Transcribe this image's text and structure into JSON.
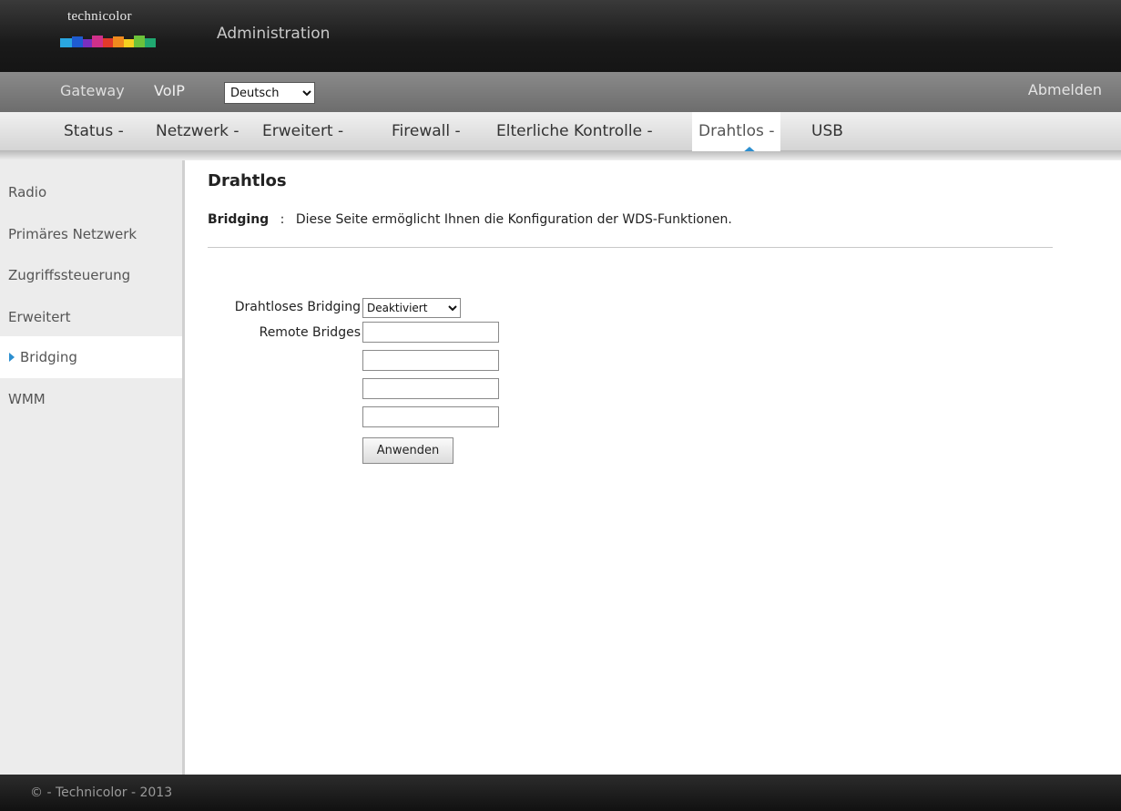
{
  "header": {
    "logo_text": "technicolor",
    "title": "Administration"
  },
  "topnav": {
    "gateway_label": "Gateway",
    "voip_label": "VoIP",
    "language_selected": "Deutsch",
    "logout_label": "Abmelden"
  },
  "mainnav": {
    "tabs": [
      {
        "label": "Status -"
      },
      {
        "label": "Netzwerk -"
      },
      {
        "label": "Erweitert -"
      },
      {
        "label": "Firewall -"
      },
      {
        "label": "Elterliche Kontrolle -"
      },
      {
        "label": "Drahtlos -",
        "active": true
      },
      {
        "label": "USB"
      }
    ]
  },
  "sidebar": {
    "items": [
      {
        "label": "Radio"
      },
      {
        "label": "Primäres Netzwerk"
      },
      {
        "label": "Zugriffssteuerung"
      },
      {
        "label": "Erweitert"
      },
      {
        "label": "Bridging",
        "active": true
      },
      {
        "label": "WMM"
      }
    ]
  },
  "main": {
    "page_title": "Drahtlos",
    "desc_label": "Bridging",
    "desc_separator": ":",
    "desc_text": "Diese Seite ermöglicht Ihnen die Konfiguration der WDS-Funktionen.",
    "wireless_bridging_label": "Drahtloses Bridging",
    "wireless_bridging_value": "Deaktiviert",
    "remote_bridges_label": "Remote Bridges",
    "remote_bridges_values": [
      "",
      "",
      "",
      ""
    ],
    "apply_label": "Anwenden"
  },
  "footer": {
    "text": "© - Technicolor - 2013"
  },
  "colors": {
    "accent": "#2c8fd0",
    "header_bg": "#1a1a1a",
    "topnav_bg": "#7a7a7a"
  }
}
